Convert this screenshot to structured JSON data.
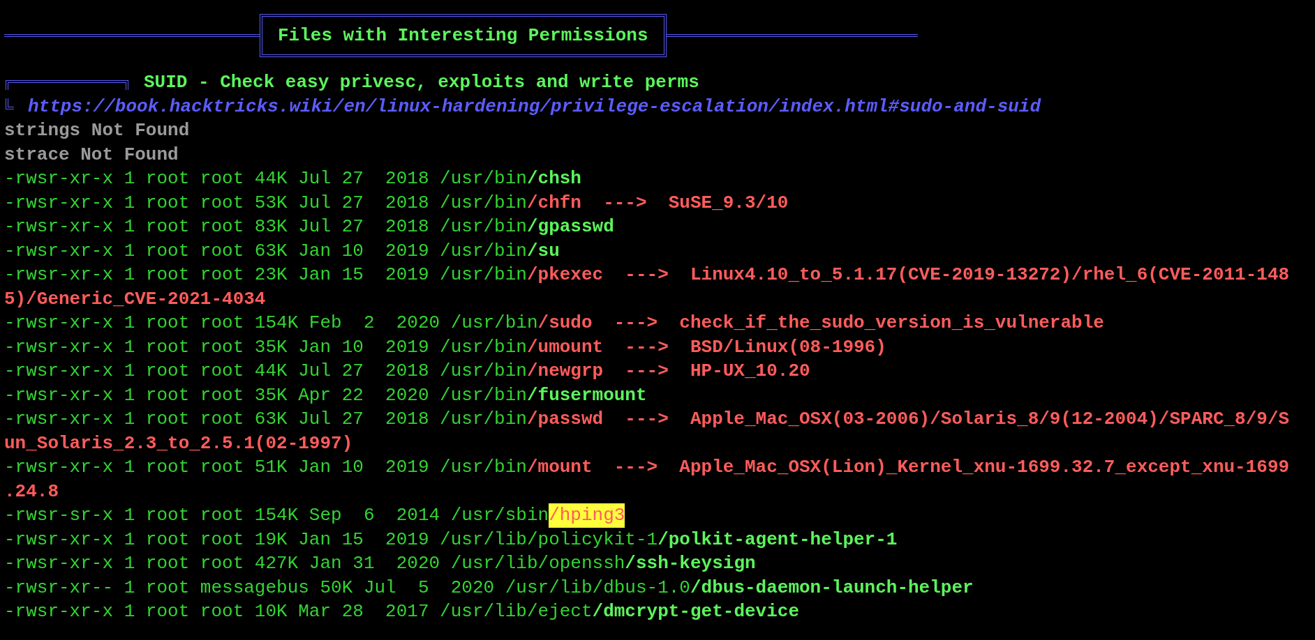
{
  "banner": {
    "title": "Files with Interesting Permissions"
  },
  "section": {
    "title": "SUID - Check easy privesc, exploits and write perms",
    "link": "https://book.hacktricks.wiki/en/linux-hardening/privilege-escalation/index.html#sudo-and-suid"
  },
  "lines": [
    {
      "segments": [
        {
          "kind": "notice",
          "text": "strings Not Found"
        }
      ]
    },
    {
      "segments": [
        {
          "kind": "notice",
          "text": "strace Not Found"
        }
      ]
    },
    {
      "segments": [
        {
          "kind": "plain",
          "text": "-rwsr-xr-x 1 root root 44K Jul 27  2018 /usr/bin"
        },
        {
          "kind": "bold",
          "text": "/chsh"
        }
      ]
    },
    {
      "segments": [
        {
          "kind": "plain",
          "text": "-rwsr-xr-x 1 root root 53K Jul 27  2018 /usr/bin"
        },
        {
          "kind": "exploit",
          "text": "/chfn  --->  SuSE_9.3/10"
        }
      ]
    },
    {
      "segments": [
        {
          "kind": "plain",
          "text": "-rwsr-xr-x 1 root root 83K Jul 27  2018 /usr/bin"
        },
        {
          "kind": "bold",
          "text": "/gpasswd"
        }
      ]
    },
    {
      "segments": [
        {
          "kind": "plain",
          "text": "-rwsr-xr-x 1 root root 63K Jan 10  2019 /usr/bin"
        },
        {
          "kind": "bold",
          "text": "/su"
        }
      ]
    },
    {
      "segments": [
        {
          "kind": "plain",
          "text": "-rwsr-xr-x 1 root root 23K Jan 15  2019 /usr/bin"
        },
        {
          "kind": "exploit",
          "text": "/pkexec  --->  Linux4.10_to_5.1.17(CVE-2019-13272)/rhel_6(CVE-2011-148"
        }
      ]
    },
    {
      "segments": [
        {
          "kind": "exploit",
          "text": "5)/Generic_CVE-2021-4034"
        }
      ]
    },
    {
      "segments": [
        {
          "kind": "plain",
          "text": "-rwsr-xr-x 1 root root 154K Feb  2  2020 /usr/bin"
        },
        {
          "kind": "exploit",
          "text": "/sudo  --->  check_if_the_sudo_version_is_vulnerable"
        }
      ]
    },
    {
      "segments": [
        {
          "kind": "plain",
          "text": "-rwsr-xr-x 1 root root 35K Jan 10  2019 /usr/bin"
        },
        {
          "kind": "exploit",
          "text": "/umount  --->  BSD/Linux(08-1996)"
        }
      ]
    },
    {
      "segments": [
        {
          "kind": "plain",
          "text": "-rwsr-xr-x 1 root root 44K Jul 27  2018 /usr/bin"
        },
        {
          "kind": "exploit",
          "text": "/newgrp  --->  HP-UX_10.20"
        }
      ]
    },
    {
      "segments": [
        {
          "kind": "plain",
          "text": "-rwsr-xr-x 1 root root 35K Apr 22  2020 /usr/bin"
        },
        {
          "kind": "bold",
          "text": "/fusermount"
        }
      ]
    },
    {
      "segments": [
        {
          "kind": "plain",
          "text": "-rwsr-xr-x 1 root root 63K Jul 27  2018 /usr/bin"
        },
        {
          "kind": "exploit",
          "text": "/passwd  --->  Apple_Mac_OSX(03-2006)/Solaris_8/9(12-2004)/SPARC_8/9/S"
        }
      ]
    },
    {
      "segments": [
        {
          "kind": "exploit",
          "text": "un_Solaris_2.3_to_2.5.1(02-1997)"
        }
      ]
    },
    {
      "segments": [
        {
          "kind": "plain",
          "text": "-rwsr-xr-x 1 root root 51K Jan 10  2019 /usr/bin"
        },
        {
          "kind": "exploit",
          "text": "/mount  --->  Apple_Mac_OSX(Lion)_Kernel_xnu-1699.32.7_except_xnu-1699"
        }
      ]
    },
    {
      "segments": [
        {
          "kind": "exploit",
          "text": ".24.8"
        }
      ]
    },
    {
      "segments": [
        {
          "kind": "plain",
          "text": "-rwsr-sr-x 1 root root 154K Sep  6  2014 /usr/sbin"
        },
        {
          "kind": "highlight",
          "text": "/hping3"
        }
      ]
    },
    {
      "segments": [
        {
          "kind": "plain",
          "text": "-rwsr-xr-x 1 root root 19K Jan 15  2019 /usr/lib/policykit-1"
        },
        {
          "kind": "bold",
          "text": "/polkit-agent-helper-1"
        }
      ]
    },
    {
      "segments": [
        {
          "kind": "plain",
          "text": "-rwsr-xr-x 1 root root 427K Jan 31  2020 /usr/lib/openssh"
        },
        {
          "kind": "bold",
          "text": "/ssh-keysign"
        }
      ]
    },
    {
      "segments": [
        {
          "kind": "plain",
          "text": "-rwsr-xr-- 1 root messagebus 50K Jul  5  2020 /usr/lib/dbus-1.0"
        },
        {
          "kind": "bold",
          "text": "/dbus-daemon-launch-helper"
        }
      ]
    },
    {
      "segments": [
        {
          "kind": "plain",
          "text": "-rwsr-xr-x 1 root root 10K Mar 28  2017 /usr/lib/eject"
        },
        {
          "kind": "bold",
          "text": "/dmcrypt-get-device"
        }
      ]
    }
  ]
}
